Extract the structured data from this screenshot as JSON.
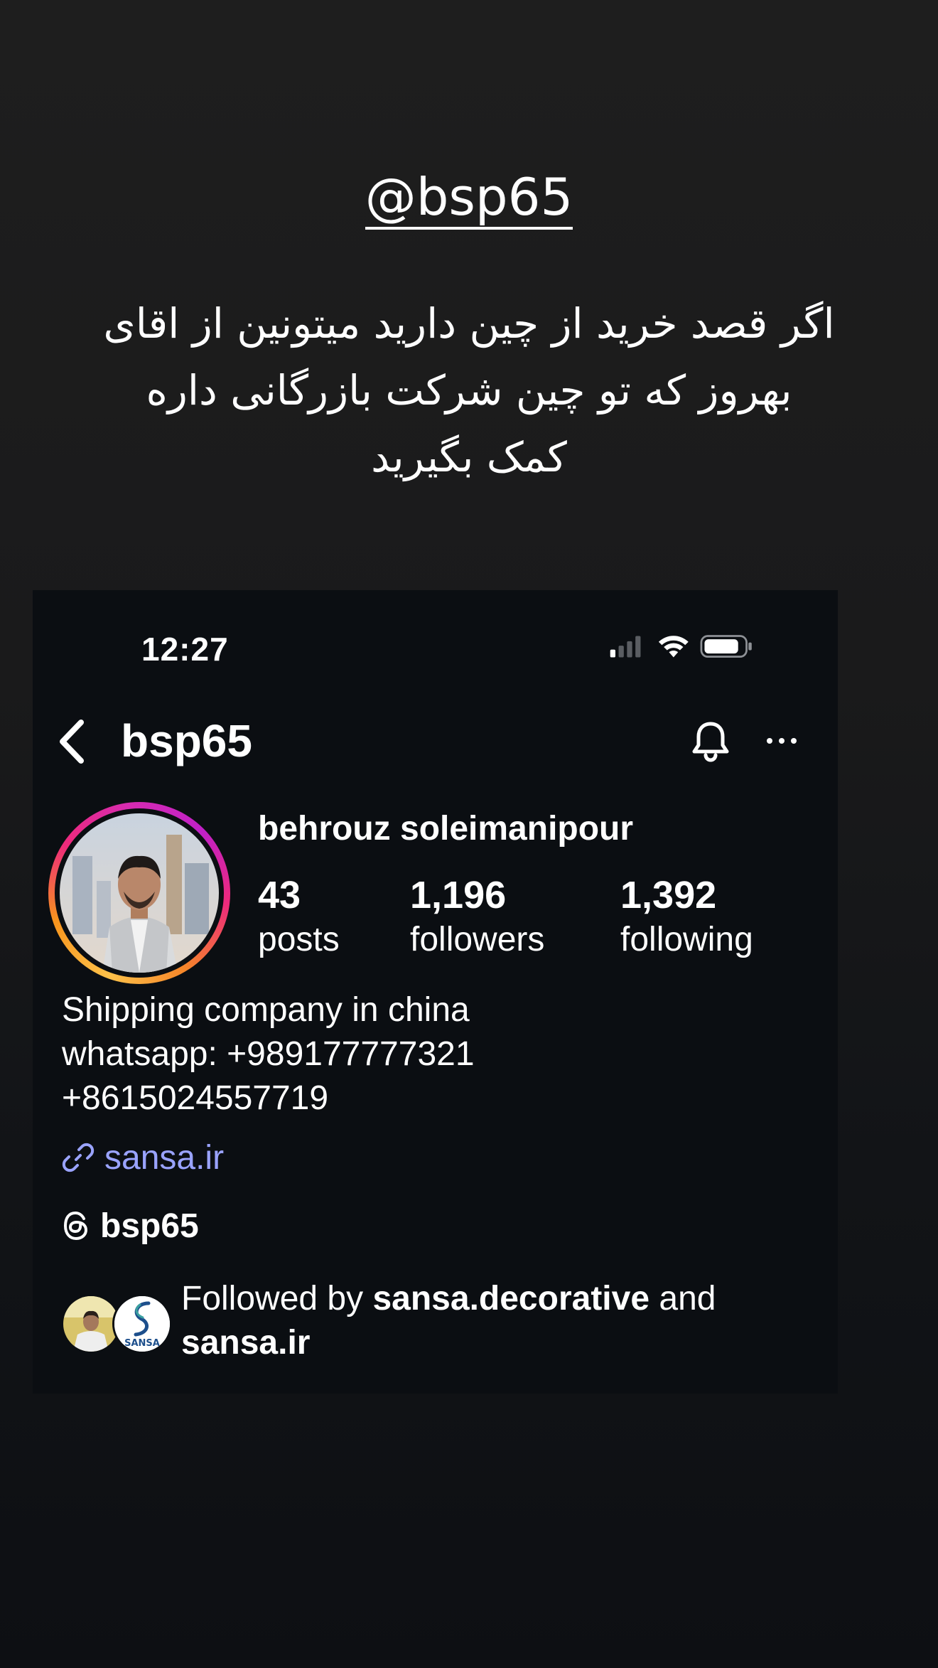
{
  "story": {
    "mention": "@bsp65",
    "caption_lines": [
      "اگر قصد خرید از چین دارید میتونین از اقای",
      "بهروز که تو چین شرکت بازرگانی داره",
      "کمک بگیرید"
    ]
  },
  "status_bar": {
    "time": "12:27"
  },
  "nav": {
    "username": "bsp65",
    "back_icon": "chevron-left-icon",
    "bell_icon": "bell-icon",
    "more_icon": "more-horizontal-icon"
  },
  "profile": {
    "full_name": "behrouz soleimanipour",
    "stats": {
      "posts": {
        "value": "43",
        "label": "posts"
      },
      "followers": {
        "value": "1,196",
        "label": "followers"
      },
      "following": {
        "value": "1,392",
        "label": "following"
      }
    },
    "bio_lines": [
      "Shipping company in china",
      "whatsapp: +989177777321",
      "+8615024557719"
    ],
    "link": "sansa.ir",
    "threads_handle": "bsp65",
    "followed_by": {
      "prefix": "Followed by ",
      "user1": "sansa.decorative",
      "middle": " and",
      "user2": "sansa.ir"
    },
    "sansa_logo_text": "SANSA"
  },
  "colors": {
    "link": "#9aa3ff",
    "card_background": "#0b0e12"
  }
}
